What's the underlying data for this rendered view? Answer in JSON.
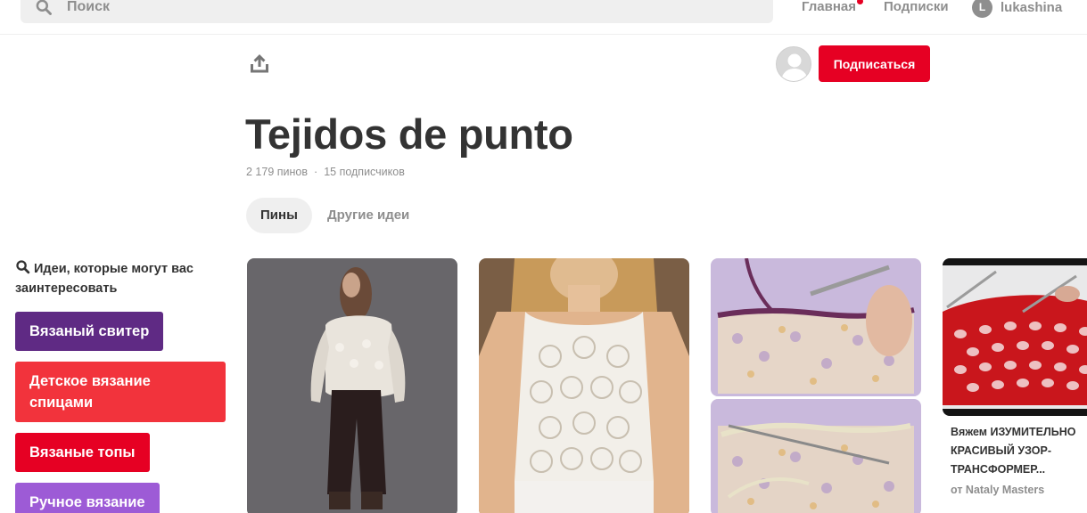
{
  "header": {
    "search_placeholder": "Поиск",
    "nav": {
      "home": "Главная",
      "subscriptions": "Подписки"
    },
    "user": {
      "initial": "L",
      "name": "lukashina"
    },
    "accent_color": "#e60023"
  },
  "board": {
    "follow_label": "Подписаться",
    "title": "Tejidos de punto",
    "pins_count": "2 179 пинов",
    "followers_count": "15 подписчиков",
    "separator": "·",
    "tabs": [
      "Пины",
      "Другие идеи"
    ]
  },
  "sidebar": {
    "heading": "Идеи, которые могут вас заинтересовать",
    "chips": [
      {
        "label": "Вязаный свитер",
        "color": "#5f2a84"
      },
      {
        "label": "Детское вязание спицами",
        "color": "#f2333c"
      },
      {
        "label": "Вязаные топы",
        "color": "#e60023"
      },
      {
        "label": "Ручное вязание",
        "color": "#9d5bd6"
      }
    ]
  },
  "pins": [
    {
      "icon": "knitted-sweater-photo"
    },
    {
      "icon": "crochet-top-photo"
    },
    {
      "icon": "crochet-edging-photo"
    },
    {
      "icon": "red-knit-pattern-photo",
      "title": "Вяжем ИЗУМИТЕЛЬНО КРАСИВЫЙ УЗОР-ТРАНСФОРМЕР...",
      "author": "от Nataly Masters"
    }
  ]
}
